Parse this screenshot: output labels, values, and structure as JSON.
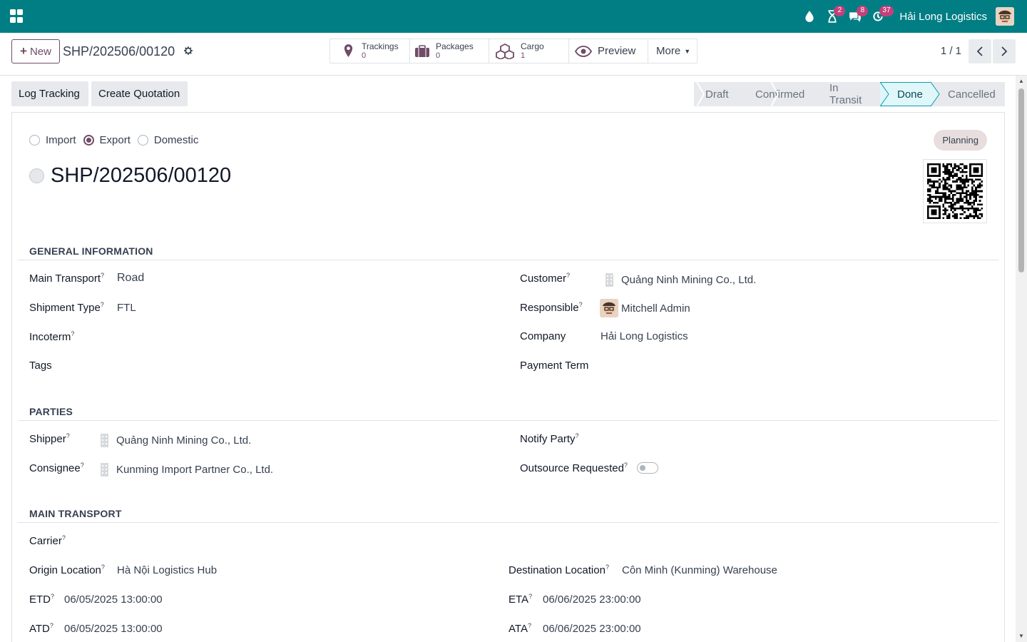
{
  "navbar": {
    "company": "Hải Long Logistics",
    "badges": {
      "activities": "2",
      "messages": "8",
      "updates": "37"
    }
  },
  "control_panel": {
    "new_label": "New",
    "record_name": "SHP/202506/00120",
    "smart_buttons": [
      {
        "label": "Trackings",
        "value": "0",
        "icon": "map-pin-icon"
      },
      {
        "label": "Packages",
        "value": "0",
        "icon": "suitcase-icon"
      },
      {
        "label": "Cargo",
        "value": "1",
        "icon": "cubes-icon"
      }
    ],
    "preview_label": "Preview",
    "more_label": "More",
    "pager": "1 / 1"
  },
  "statusbar": {
    "actions": [
      "Log Tracking",
      "Create Quotation"
    ],
    "stages": [
      "Draft",
      "Confirmed",
      "In Transit",
      "Done",
      "Cancelled"
    ],
    "active_stage": "Done"
  },
  "form": {
    "direction_options": [
      "Import",
      "Export",
      "Domestic"
    ],
    "direction_selected": "Export",
    "state_badge": "Planning",
    "name": "SHP/202506/00120",
    "sections": {
      "general": "GENERAL INFORMATION",
      "parties": "PARTIES",
      "transport": "MAIN TRANSPORT"
    },
    "general": {
      "main_transport_label": "Main Transport",
      "main_transport": "Road",
      "shipment_type_label": "Shipment Type",
      "shipment_type": "FTL",
      "incoterm_label": "Incoterm",
      "tags_label": "Tags",
      "customer_label": "Customer",
      "customer": "Quảng Ninh Mining Co., Ltd.",
      "responsible_label": "Responsible",
      "responsible": "Mitchell Admin",
      "company_label": "Company",
      "company": "Hải Long Logistics",
      "payment_term_label": "Payment Term"
    },
    "parties": {
      "shipper_label": "Shipper",
      "shipper": "Quảng Ninh Mining Co., Ltd.",
      "consignee_label": "Consignee",
      "consignee": "Kunming Import Partner Co., Ltd.",
      "notify_label": "Notify Party",
      "outsource_label": "Outsource Requested",
      "outsource_value": false
    },
    "transport": {
      "carrier_label": "Carrier",
      "origin_label": "Origin Location",
      "origin": "Hà Nội Logistics Hub",
      "destination_label": "Destination Location",
      "destination": "Côn Minh (Kunming) Warehouse",
      "etd_label": "ETD",
      "etd": "06/05/2025 13:00:00",
      "eta_label": "ETA",
      "eta": "06/06/2025 23:00:00",
      "atd_label": "ATD",
      "atd": "06/05/2025 13:00:00",
      "ata_label": "ATA",
      "ata": "06/06/2025 23:00:00"
    },
    "help_mark": "?"
  }
}
